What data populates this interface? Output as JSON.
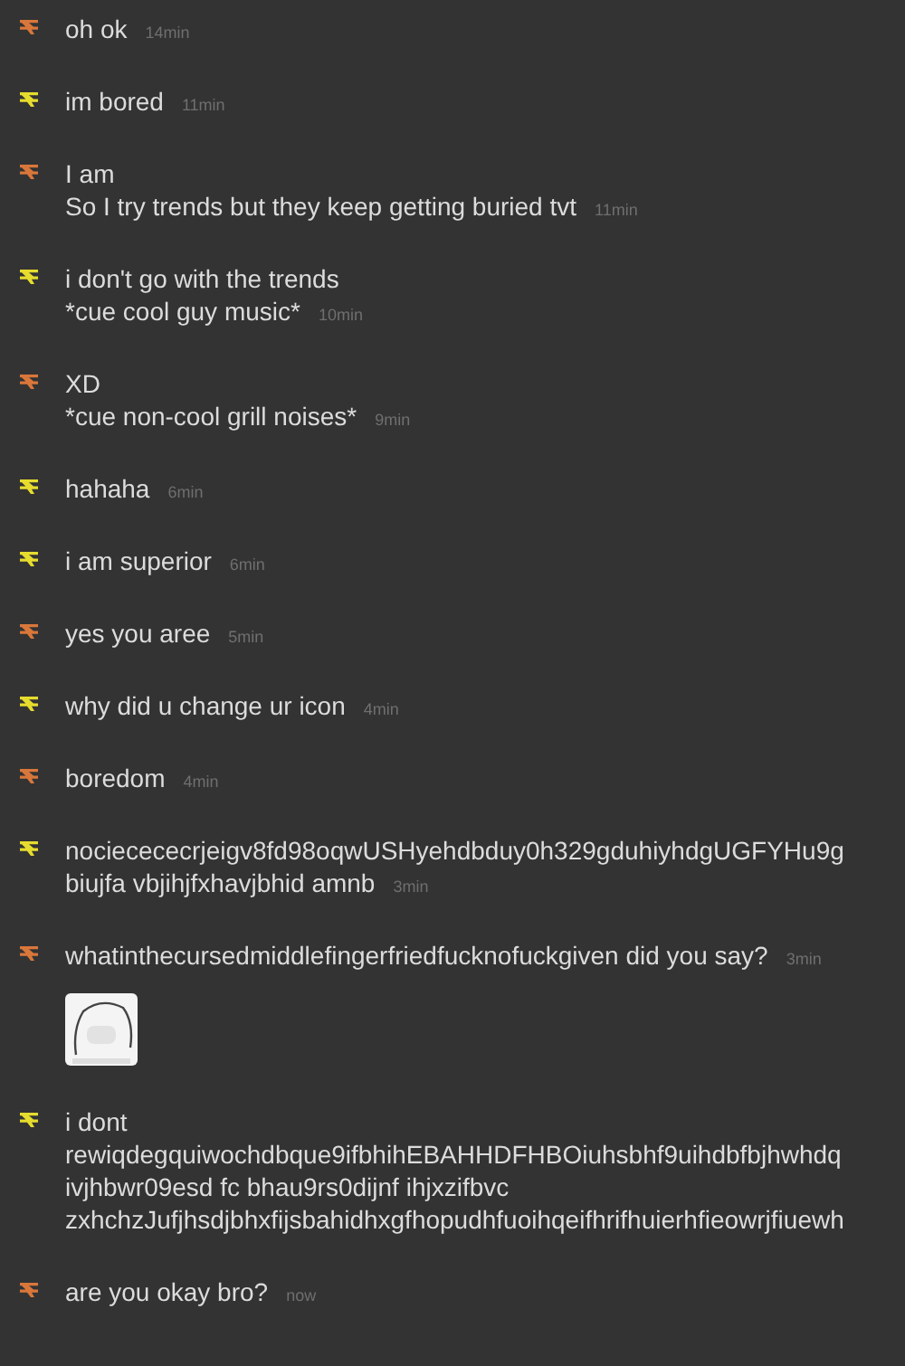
{
  "messages": [
    {
      "kind": "text",
      "color": "#d9773b",
      "lines": [
        "oh ok"
      ],
      "time": "14min"
    },
    {
      "kind": "text",
      "color": "#e6dc2e",
      "lines": [
        "im bored"
      ],
      "time": "11min"
    },
    {
      "kind": "text",
      "color": "#d9773b",
      "lines": [
        "I am",
        "So I try trends but they keep getting buried tvt"
      ],
      "time": "11min"
    },
    {
      "kind": "text",
      "color": "#e6dc2e",
      "lines": [
        "i don't go with the trends",
        "*cue cool guy music*"
      ],
      "time": "10min"
    },
    {
      "kind": "text",
      "color": "#d9773b",
      "lines": [
        "XD",
        "*cue non-cool grill noises*"
      ],
      "time": "9min"
    },
    {
      "kind": "text",
      "color": "#e6dc2e",
      "lines": [
        "hahaha"
      ],
      "time": "6min"
    },
    {
      "kind": "text",
      "color": "#e6dc2e",
      "lines": [
        "i am superior"
      ],
      "time": "6min"
    },
    {
      "kind": "text",
      "color": "#d9773b",
      "lines": [
        "yes you aree"
      ],
      "time": "5min"
    },
    {
      "kind": "text",
      "color": "#e6dc2e",
      "lines": [
        "why did u change ur icon"
      ],
      "time": "4min"
    },
    {
      "kind": "text",
      "color": "#d9773b",
      "lines": [
        "boredom"
      ],
      "time": "4min"
    },
    {
      "kind": "text",
      "color": "#e6dc2e",
      "lines": [
        "nociecececrjeigv8fd98oqwUSHyehdbduy0h329gduhiyhdgUGFYHu9g",
        "biujfa vbjihjfxhavjbhid amnb"
      ],
      "time": "3min"
    },
    {
      "kind": "text",
      "color": "#d9773b",
      "lines": [
        "whatinthecursedmiddlefingerfriedfucknofuckgiven did you say?"
      ],
      "time": "3min"
    },
    {
      "kind": "sticker"
    },
    {
      "kind": "text",
      "color": "#e6dc2e",
      "lines": [
        "i dont",
        "rewiqdegquiwochdbque9ifbhihEBAHHDFHBOiuhsbhf9uihdbfbjhwhdq",
        "ivjhbwr09esd fc bhau9rs0dijnf ihjxzifbvc",
        "zxhchzJufjhsdjbhxfijsbahidhxgfhopudhfuoihqeifhrifhuierhfieowrjfiuewh"
      ]
    },
    {
      "kind": "text",
      "color": "#d9773b",
      "lines": [
        "are you okay bro?"
      ],
      "time": "now"
    }
  ]
}
